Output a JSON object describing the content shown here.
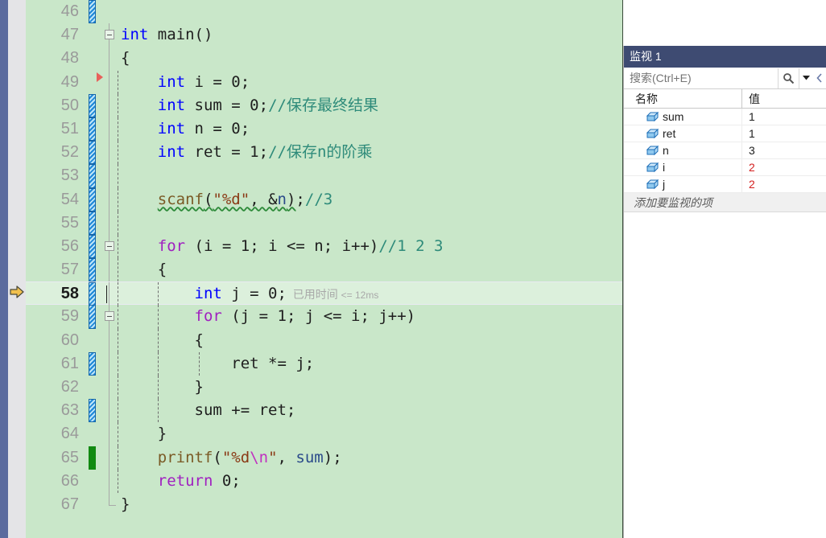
{
  "editor": {
    "language": "c",
    "current_line": 58,
    "elapsed_annotation_label": "已用时间",
    "elapsed_annotation_value": "<= 12ms",
    "lines": [
      {
        "no": "46",
        "marker": "unsaved",
        "fold": "none",
        "indent": 0,
        "tokens": []
      },
      {
        "no": "47",
        "marker": "none",
        "fold": "collapse",
        "indent": 0,
        "tokens": [
          {
            "t": "int ",
            "c": "kw"
          },
          {
            "t": "main",
            "c": "ident"
          },
          {
            "t": "()",
            "c": "ident"
          }
        ]
      },
      {
        "no": "48",
        "marker": "none",
        "fold": "line",
        "indent": 0,
        "tokens": [
          {
            "t": "{",
            "c": "ident"
          }
        ]
      },
      {
        "no": "49",
        "marker": "redtri",
        "fold": "line",
        "indent": 1,
        "tokens": [
          {
            "t": "    ",
            "c": "ident"
          },
          {
            "t": "int",
            "c": "kw"
          },
          {
            "t": " i = ",
            "c": "ident"
          },
          {
            "t": "0",
            "c": "num"
          },
          {
            "t": ";",
            "c": "ident"
          }
        ]
      },
      {
        "no": "50",
        "marker": "unsaved",
        "fold": "line",
        "indent": 1,
        "tokens": [
          {
            "t": "    ",
            "c": "ident"
          },
          {
            "t": "int",
            "c": "kw"
          },
          {
            "t": " sum = ",
            "c": "ident"
          },
          {
            "t": "0",
            "c": "num"
          },
          {
            "t": ";",
            "c": "ident"
          },
          {
            "t": "//保存最终结果",
            "c": "cmt"
          }
        ]
      },
      {
        "no": "51",
        "marker": "unsaved",
        "fold": "line",
        "indent": 1,
        "tokens": [
          {
            "t": "    ",
            "c": "ident"
          },
          {
            "t": "int",
            "c": "kw"
          },
          {
            "t": " n = ",
            "c": "ident"
          },
          {
            "t": "0",
            "c": "num"
          },
          {
            "t": ";",
            "c": "ident"
          }
        ]
      },
      {
        "no": "52",
        "marker": "unsaved",
        "fold": "line",
        "indent": 1,
        "tokens": [
          {
            "t": "    ",
            "c": "ident"
          },
          {
            "t": "int",
            "c": "kw"
          },
          {
            "t": " ret = ",
            "c": "ident"
          },
          {
            "t": "1",
            "c": "num"
          },
          {
            "t": ";",
            "c": "ident"
          },
          {
            "t": "//保存n的阶乘",
            "c": "cmt"
          }
        ]
      },
      {
        "no": "53",
        "marker": "unsaved",
        "fold": "line",
        "indent": 1,
        "tokens": []
      },
      {
        "no": "54",
        "marker": "unsaved",
        "fold": "line",
        "indent": 1,
        "tokens": [
          {
            "t": "    ",
            "c": "ident"
          },
          {
            "t": "scanf",
            "c": "fn",
            "sq": true
          },
          {
            "t": "(",
            "c": "ident",
            "sq": true
          },
          {
            "t": "\"%d\"",
            "c": "str",
            "sq": true
          },
          {
            "t": ", &",
            "c": "ident",
            "sq": true
          },
          {
            "t": "n",
            "c": "var",
            "sq": true
          },
          {
            "t": ")",
            "c": "ident",
            "sq": true
          },
          {
            "t": ";",
            "c": "ident"
          },
          {
            "t": "//3",
            "c": "cmt"
          }
        ]
      },
      {
        "no": "55",
        "marker": "unsaved",
        "fold": "line",
        "indent": 1,
        "tokens": []
      },
      {
        "no": "56",
        "marker": "unsaved",
        "fold": "collapse",
        "indent": 1,
        "tokens": [
          {
            "t": "    ",
            "c": "ident"
          },
          {
            "t": "for",
            "c": "kwctl"
          },
          {
            "t": " (i = ",
            "c": "ident"
          },
          {
            "t": "1",
            "c": "num"
          },
          {
            "t": "; i <= n; i++)",
            "c": "ident"
          },
          {
            "t": "//1 2 3",
            "c": "cmt"
          }
        ]
      },
      {
        "no": "57",
        "marker": "unsaved",
        "fold": "line",
        "indent": 1,
        "tokens": [
          {
            "t": "    ",
            "c": "ident"
          },
          {
            "t": "{",
            "c": "ident"
          }
        ]
      },
      {
        "no": "58",
        "marker": "unsaved",
        "fold": "line",
        "indent": 2,
        "current": true,
        "tokens": [
          {
            "t": "        ",
            "c": "ident"
          },
          {
            "t": "int",
            "c": "kw"
          },
          {
            "t": " j = ",
            "c": "ident"
          },
          {
            "t": "0",
            "c": "num"
          },
          {
            "t": ";",
            "c": "ident"
          }
        ]
      },
      {
        "no": "59",
        "marker": "unsaved",
        "fold": "collapse",
        "indent": 2,
        "tokens": [
          {
            "t": "        ",
            "c": "ident"
          },
          {
            "t": "for",
            "c": "kwctl"
          },
          {
            "t": " (j = ",
            "c": "ident"
          },
          {
            "t": "1",
            "c": "num"
          },
          {
            "t": "; j <= i; j++)",
            "c": "ident"
          }
        ]
      },
      {
        "no": "60",
        "marker": "none",
        "fold": "line",
        "indent": 2,
        "tokens": [
          {
            "t": "        ",
            "c": "ident"
          },
          {
            "t": "{",
            "c": "ident"
          }
        ]
      },
      {
        "no": "61",
        "marker": "unsaved",
        "fold": "line",
        "indent": 3,
        "tokens": [
          {
            "t": "            ",
            "c": "ident"
          },
          {
            "t": "ret *= j;",
            "c": "ident"
          }
        ]
      },
      {
        "no": "62",
        "marker": "none",
        "fold": "line",
        "indent": 2,
        "tokens": [
          {
            "t": "        ",
            "c": "ident"
          },
          {
            "t": "}",
            "c": "ident"
          }
        ]
      },
      {
        "no": "63",
        "marker": "unsaved",
        "fold": "line",
        "indent": 2,
        "tokens": [
          {
            "t": "        ",
            "c": "ident"
          },
          {
            "t": "sum += ret;",
            "c": "ident"
          }
        ]
      },
      {
        "no": "64",
        "marker": "none",
        "fold": "line",
        "indent": 1,
        "tokens": [
          {
            "t": "    ",
            "c": "ident"
          },
          {
            "t": "}",
            "c": "ident"
          }
        ]
      },
      {
        "no": "65",
        "marker": "saved",
        "fold": "line",
        "indent": 1,
        "tokens": [
          {
            "t": "    ",
            "c": "ident"
          },
          {
            "t": "printf",
            "c": "fn"
          },
          {
            "t": "(",
            "c": "ident"
          },
          {
            "t": "\"%d",
            "c": "str"
          },
          {
            "t": "\\n",
            "c": "esc"
          },
          {
            "t": "\"",
            "c": "str"
          },
          {
            "t": ", ",
            "c": "ident"
          },
          {
            "t": "sum",
            "c": "var"
          },
          {
            "t": ");",
            "c": "ident"
          }
        ]
      },
      {
        "no": "66",
        "marker": "none",
        "fold": "line",
        "indent": 1,
        "tokens": [
          {
            "t": "    ",
            "c": "ident"
          },
          {
            "t": "return",
            "c": "kwctl"
          },
          {
            "t": " ",
            "c": "ident"
          },
          {
            "t": "0",
            "c": "num"
          },
          {
            "t": ";",
            "c": "ident"
          }
        ]
      },
      {
        "no": "67",
        "marker": "none",
        "fold": "end",
        "indent": 0,
        "tokens": [
          {
            "t": "}",
            "c": "ident"
          }
        ]
      }
    ]
  },
  "watch": {
    "title": "监视 1",
    "search_placeholder": "搜索(Ctrl+E)",
    "search_value": "",
    "columns": {
      "name": "名称",
      "value": "值"
    },
    "rows": [
      {
        "name": "sum",
        "value": "1",
        "changed": false
      },
      {
        "name": "ret",
        "value": "1",
        "changed": false
      },
      {
        "name": "n",
        "value": "3",
        "changed": false
      },
      {
        "name": "i",
        "value": "2",
        "changed": true
      },
      {
        "name": "j",
        "value": "2",
        "changed": true
      }
    ],
    "add_row_label": "添加要监视的项"
  },
  "colors": {
    "editor_background": "#C9E7C9",
    "current_line_highlight": "#DCF0DC",
    "watch_title_background": "#3E4B72",
    "indicator_strip": "#5B6B9E",
    "glyph_margin": "#E4E4E7",
    "keyword": "#0000FF",
    "control_keyword": "#A020C0",
    "comment": "#2E8B7A",
    "string": "#8A3A15",
    "changed_value": "#D42020",
    "unsaved_change_bar": "#1E88D8",
    "saved_change_bar": "#128A12",
    "current_statement_arrow": "#F2C14E"
  }
}
